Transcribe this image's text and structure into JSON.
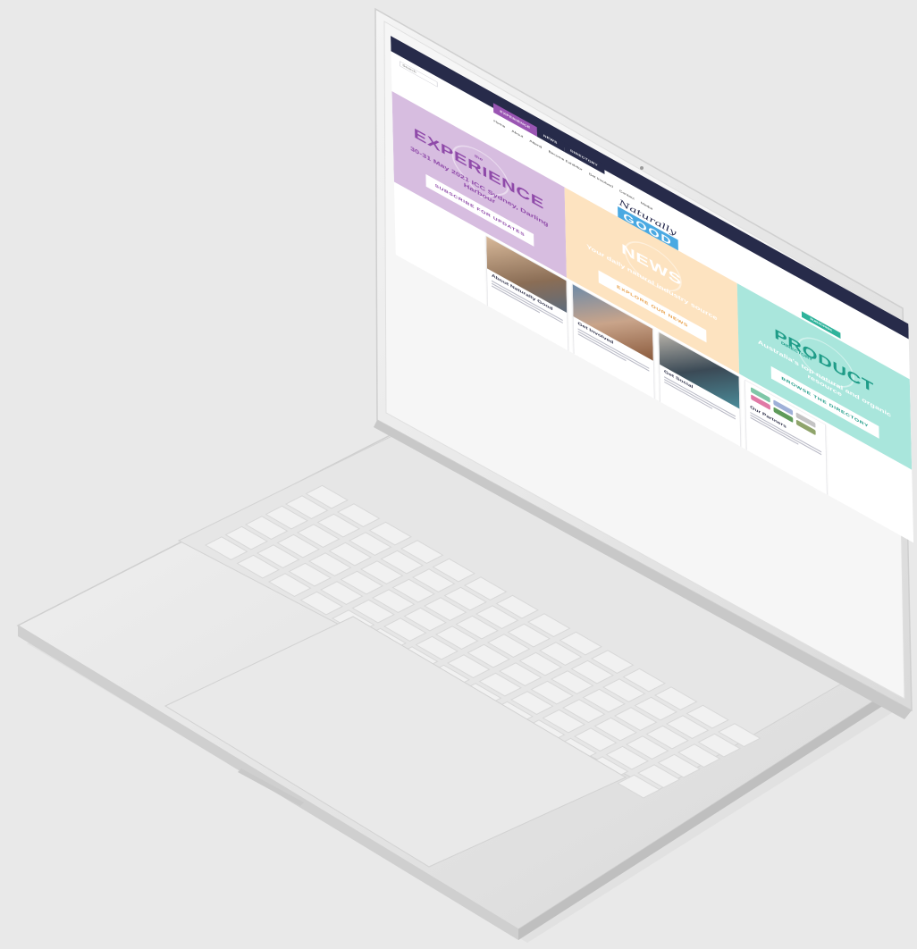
{
  "site": {
    "search_placeholder": "Search",
    "tabs": [
      {
        "label": "EXPERIENCE"
      },
      {
        "label": "NEWS"
      },
      {
        "label": "DIRECTORY"
      }
    ],
    "nav": [
      "Home",
      "About",
      "Attend",
      "Become Exhibitor",
      "Get Involved",
      "Contact",
      "Media"
    ],
    "logo": {
      "script": "Naturally",
      "word": "GOOD"
    },
    "cta": "SUBSCRIBE",
    "panels": [
      {
        "key": "experience",
        "small": "the",
        "title": "EXPERIENCE",
        "subtitle": "30-31 May 2021 ICC Sydney, Darling Harbour",
        "button": "SUBSCRIBE FOR UPDATES",
        "color": "#d7bde0"
      },
      {
        "key": "news",
        "small": "",
        "title": "NEWS",
        "subtitle": "Your daily natural industry source",
        "button": "EXPLORE OUR NEWS",
        "color": "#fde3c0"
      },
      {
        "key": "product",
        "small": "DIRECTORY",
        "title": "PRODUCT",
        "subtitle": "Australia's top natural and organic resource",
        "button": "BROWSE THE DIRECTORY",
        "color": "#a9e6dc"
      }
    ],
    "cards": [
      {
        "title": "About Naturally Good"
      },
      {
        "title": "Get Involved"
      },
      {
        "title": "Get Social"
      },
      {
        "title": "Our Partners"
      }
    ]
  },
  "colors": {
    "navy": "#272b4a",
    "purple": "#9a55b3",
    "peach": "#fde3c0",
    "mint": "#a9e6dc",
    "teal": "#2fb39b",
    "laptop_silver": "#e4e4e4"
  },
  "icons": [
    "map-pin-icon",
    "magnifier-icon",
    "play-icon"
  ]
}
